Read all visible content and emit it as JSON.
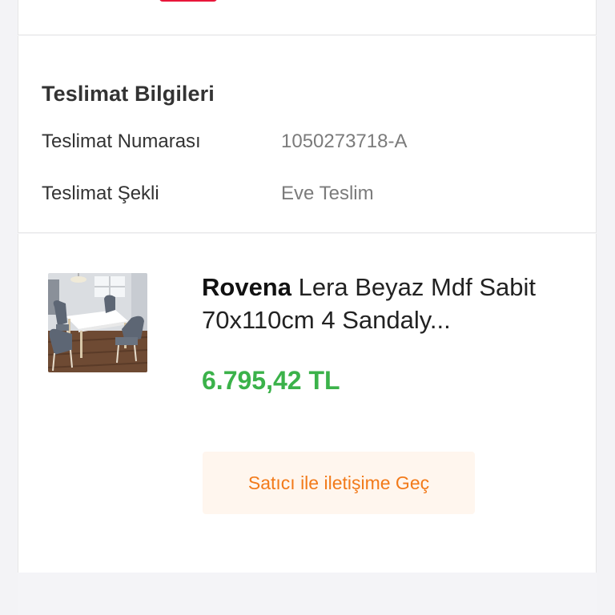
{
  "delivery_info": {
    "title": "Teslimat Bilgileri",
    "rows": [
      {
        "label": "Teslimat Numarası",
        "value": "1050273718-A"
      },
      {
        "label": "Teslimat Şekli",
        "value": "Eve Teslim"
      }
    ]
  },
  "product": {
    "brand": "Rovena",
    "name": " Lera Beyaz Mdf Sabit 70x110cm 4 Sandaly...",
    "price": "6.795,42 TL",
    "contact_button_label": "Satıcı ile iletişime Geç"
  },
  "colors": {
    "price": "#3bb24a",
    "accent_orange": "#f27a1a",
    "badge_red": "#e8163a"
  },
  "icons": {
    "top_badge": "red-badge",
    "product_image": "dining-table-set-image"
  }
}
